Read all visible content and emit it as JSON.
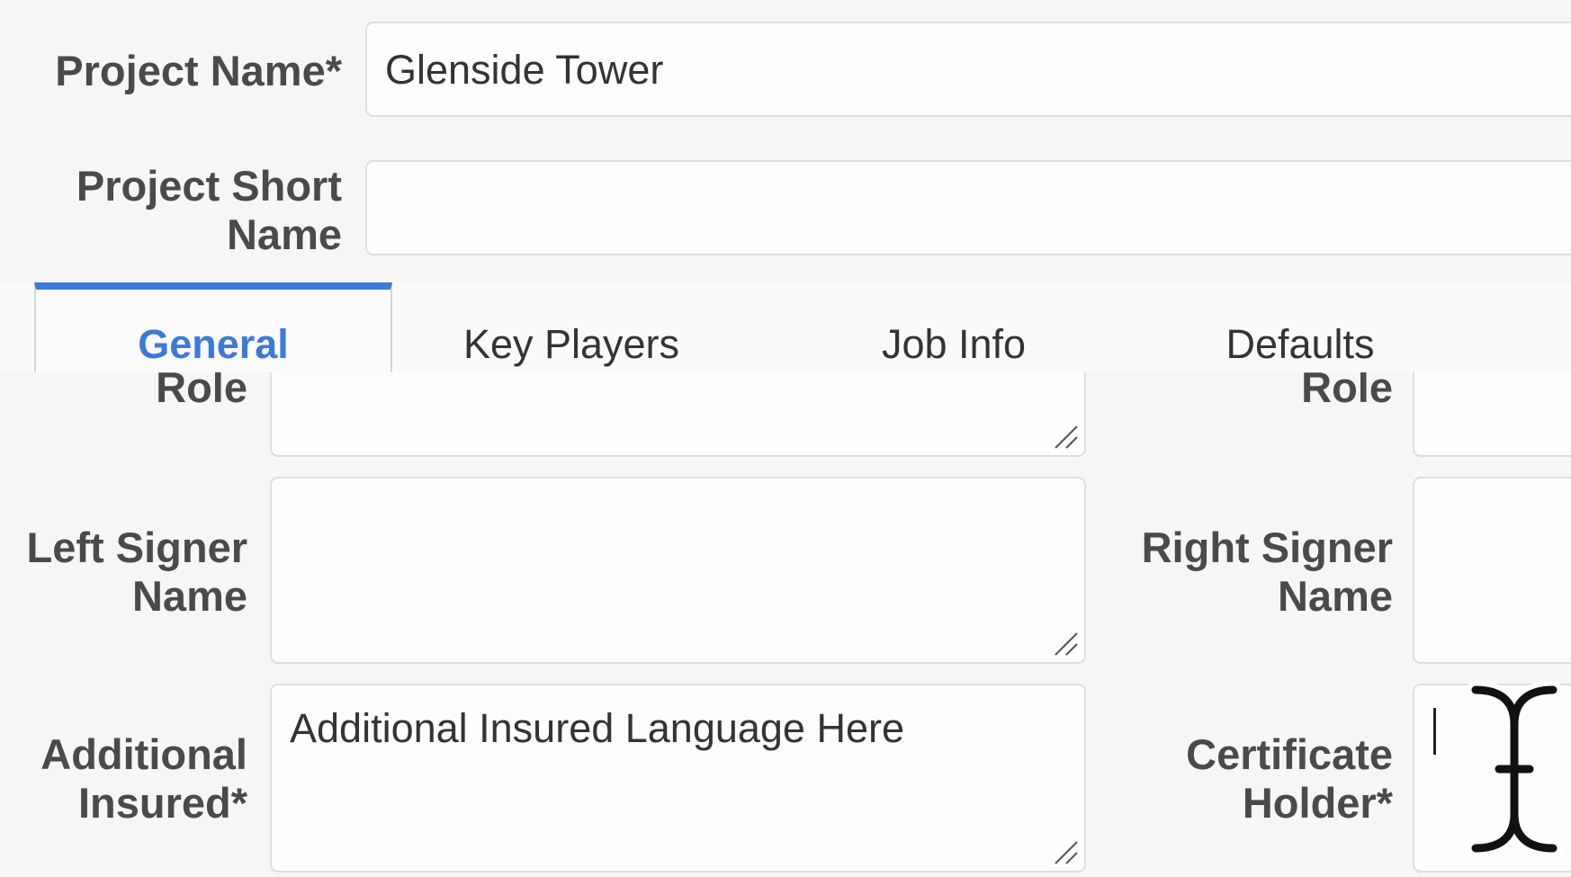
{
  "project": {
    "name_label": "Project Name*",
    "name_value": "Glenside Tower",
    "short_name_label_line1": "Project Short",
    "short_name_label_line2": "Name",
    "short_name_value": ""
  },
  "tabs": [
    {
      "label": "General",
      "active": true
    },
    {
      "label": "Key Players",
      "active": false
    },
    {
      "label": "Job Info",
      "active": false
    },
    {
      "label": "Defaults",
      "active": false
    }
  ],
  "form": {
    "left_role_label": "Role",
    "right_role_label": "Role",
    "left_signer_label_line1": "Left Signer",
    "left_signer_label_line2": "Name",
    "right_signer_label_line1": "Right Signer",
    "right_signer_label_line2": "Name",
    "additional_insured_label_line1": "Additional",
    "additional_insured_label_line2": "Insured*",
    "additional_insured_value": "Additional Insured Language Here",
    "certificate_holder_label_line1": "Certificate",
    "certificate_holder_label_line2": "Holder*",
    "certificate_holder_value": ""
  },
  "colors": {
    "accent": "#3c7ad6",
    "background": "#f6f6f6",
    "field_background": "#fdfdfd",
    "field_border": "#dedede"
  },
  "icons": [
    "resize-grip-icon",
    "text-cursor-icon"
  ]
}
